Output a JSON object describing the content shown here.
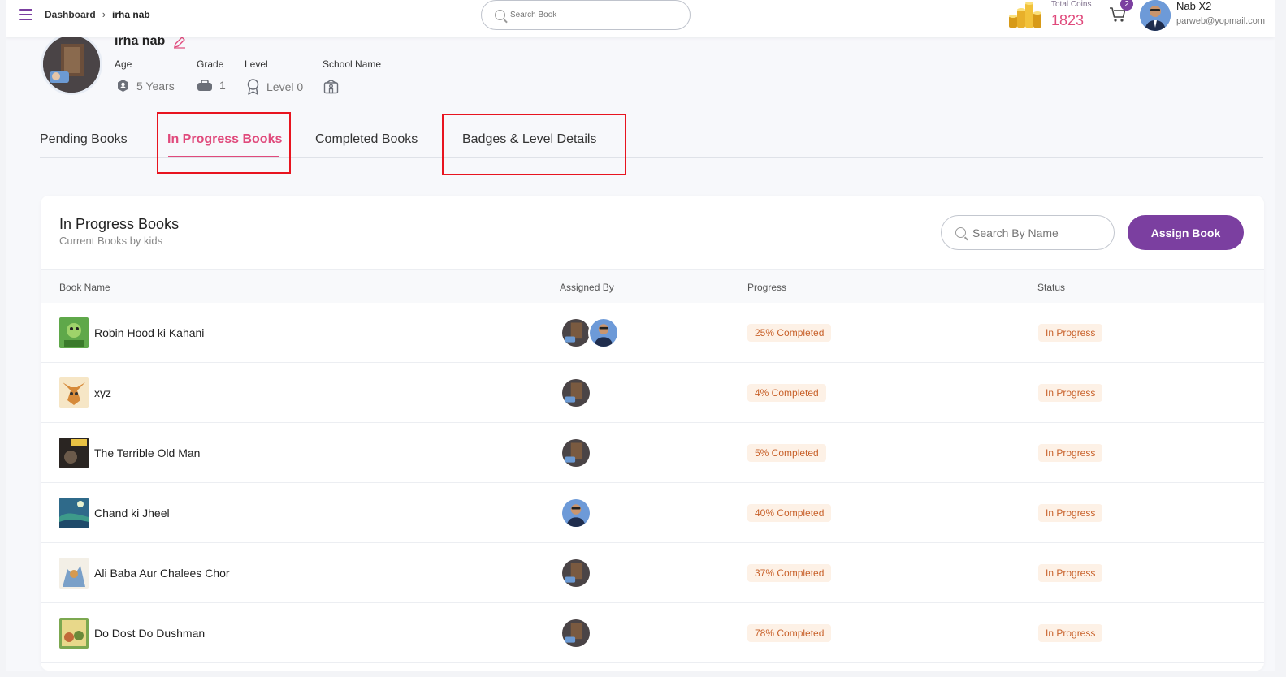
{
  "header": {
    "breadcrumb": {
      "home": "Dashboard",
      "current": "irha nab"
    },
    "search_placeholder": "Search Book",
    "coins": {
      "label": "Total Coins",
      "value": "1823"
    },
    "cart_count": "2",
    "user": {
      "name": "Nab X2",
      "email": "parweb@yopmail.com"
    }
  },
  "profile": {
    "name": "irha nab",
    "fields": {
      "age_label": "Age",
      "age_value": "5 Years",
      "grade_label": "Grade",
      "grade_value": "1",
      "level_label": "Level",
      "level_value": "Level 0",
      "school_label": "School Name",
      "school_value": ""
    }
  },
  "tabs": [
    {
      "label": "Pending Books",
      "active": false
    },
    {
      "label": "In Progress Books",
      "active": true
    },
    {
      "label": "Completed Books",
      "active": false
    },
    {
      "label": "Badges & Level Details",
      "active": false
    }
  ],
  "card": {
    "title": "In Progress Books",
    "subtitle": "Current Books by kids",
    "search_placeholder": "Search By Name",
    "assign_label": "Assign Book",
    "columns": [
      "Book Name",
      "Assigned By",
      "Progress",
      "Status"
    ],
    "rows": [
      {
        "book": "Robin Hood ki Kahani",
        "assigned_by": [
          "kid",
          "parent"
        ],
        "progress": "25% Completed",
        "status": "In Progress"
      },
      {
        "book": "xyz",
        "assigned_by": [
          "kid"
        ],
        "progress": "4% Completed",
        "status": "In Progress"
      },
      {
        "book": "The Terrible Old Man",
        "assigned_by": [
          "kid"
        ],
        "progress": "5% Completed",
        "status": "In Progress"
      },
      {
        "book": "Chand ki Jheel",
        "assigned_by": [
          "parent"
        ],
        "progress": "40% Completed",
        "status": "In Progress"
      },
      {
        "book": "Ali Baba Aur Chalees Chor",
        "assigned_by": [
          "kid"
        ],
        "progress": "37% Completed",
        "status": "In Progress"
      },
      {
        "book": "Do Dost Do Dushman",
        "assigned_by": [
          "kid"
        ],
        "progress": "78% Completed",
        "status": "In Progress"
      }
    ]
  },
  "colors": {
    "accent": "#e04a7c",
    "brand": "#7b3fa0",
    "highlight": "#e8141f",
    "pill_bg": "#fdf1e6",
    "pill_text": "#c8612a"
  }
}
